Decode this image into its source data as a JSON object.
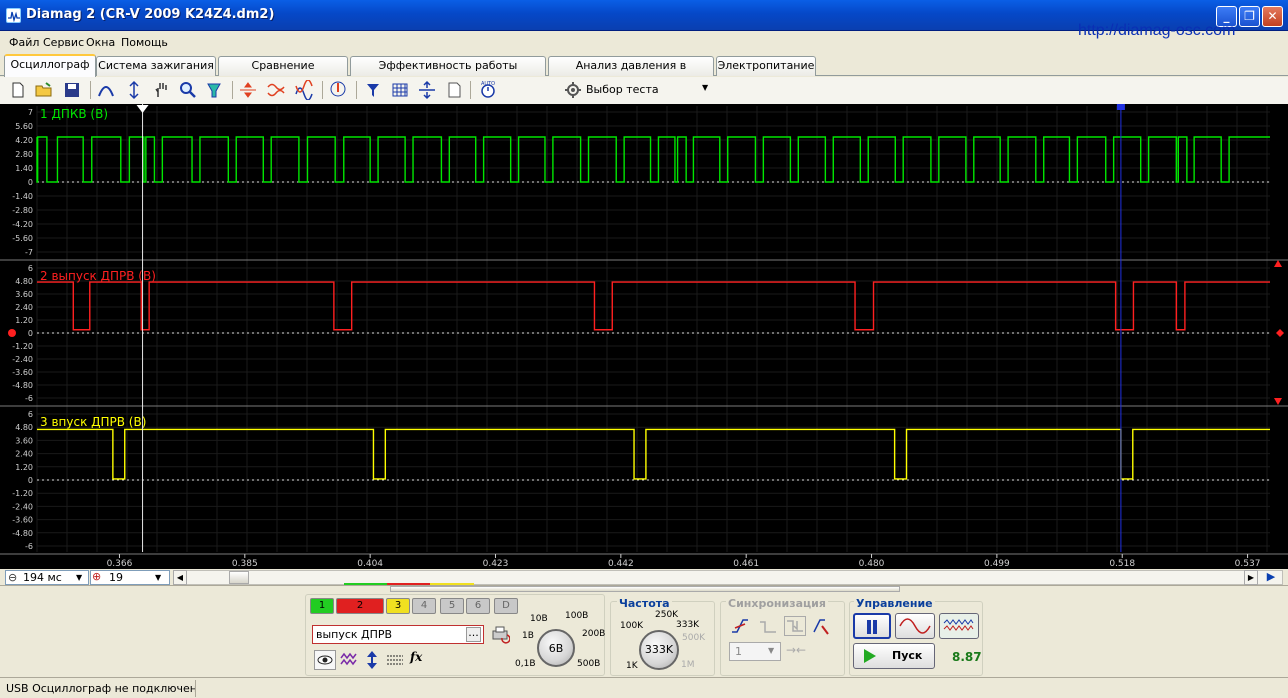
{
  "window": {
    "title": "Diamag 2 (CR-V 2009 K24Z4.dm2)",
    "url": "http://diamag-osc.com"
  },
  "menu": [
    "Файл",
    "Сервис",
    "Окна",
    "Помощь"
  ],
  "tabs": [
    {
      "label": "Осциллограф",
      "active": true
    },
    {
      "label": "Система зажигания"
    },
    {
      "label": "Сравнение цилиндров"
    },
    {
      "label": "Эффективность работы цилиндров"
    },
    {
      "label": "Анализ давления в цилиндре"
    },
    {
      "label": "Электропитание"
    }
  ],
  "toolbar": {
    "icons": [
      "new-file-icon",
      "open-folder-icon",
      "save-icon",
      "signal-arc-icon",
      "cursor-measure-icon",
      "hand-pan-icon",
      "zoom-icon",
      "probe-icon",
      "compress-icon",
      "invert-icon",
      "overlay-icon",
      "auto-scale-icon",
      "filter-icon",
      "grid-icon",
      "split-icon",
      "page-icon",
      "auto-timer-icon"
    ],
    "test_select": "Выбор теста"
  },
  "chart_data": {
    "type": "line",
    "xlabel": "",
    "ylabel": "",
    "x_ticks": [
      "0.366",
      "0.385",
      "0.404",
      "0.423",
      "0.442",
      "0.461",
      "0.480",
      "0.499",
      "0.518",
      "0.537"
    ],
    "xlim": [
      0.3535,
      0.5404
    ],
    "cursor_positions": [
      0.3695,
      0.5178
    ],
    "channels": [
      {
        "name": "1 ДПКВ (В)",
        "color": "#00e600",
        "ylim": [
          -7,
          7
        ],
        "y_ticks": [
          "7",
          "5.60",
          "4.20",
          "2.80",
          "1.40",
          "0",
          "-1.40",
          "-2.80",
          "-4.20",
          "-5.60",
          "-7"
        ],
        "low": 0,
        "high": 4.5,
        "low_pulses": [
          [
            0.3535,
            0.3536
          ],
          [
            0.355,
            0.3566
          ],
          [
            0.3605,
            0.3618
          ],
          [
            0.3662,
            0.3675
          ],
          [
            0.3697,
            0.37
          ],
          [
            0.3713,
            0.3725
          ],
          [
            0.377,
            0.3782
          ],
          [
            0.3825,
            0.3837
          ],
          [
            0.3878,
            0.389
          ],
          [
            0.3932,
            0.3945
          ],
          [
            0.3987,
            0.4
          ],
          [
            0.404,
            0.4052
          ],
          [
            0.4093,
            0.4105
          ],
          [
            0.4148,
            0.416
          ],
          [
            0.42,
            0.4212
          ],
          [
            0.4253,
            0.4265
          ],
          [
            0.4305,
            0.4317
          ],
          [
            0.4359,
            0.4371
          ],
          [
            0.4413,
            0.4425
          ],
          [
            0.4465,
            0.4477
          ],
          [
            0.4502,
            0.4506
          ],
          [
            0.4519,
            0.453
          ],
          [
            0.457,
            0.4582
          ],
          [
            0.4624,
            0.4636
          ],
          [
            0.4677,
            0.4689
          ],
          [
            0.473,
            0.4742
          ],
          [
            0.4783,
            0.4795
          ],
          [
            0.4836,
            0.4848
          ],
          [
            0.489,
            0.4902
          ],
          [
            0.4943,
            0.4955
          ],
          [
            0.4995,
            0.5007
          ],
          [
            0.5049,
            0.5061
          ],
          [
            0.51,
            0.5112
          ],
          [
            0.5155,
            0.5167
          ],
          [
            0.5208,
            0.522
          ],
          [
            0.5262,
            0.5265
          ],
          [
            0.5278,
            0.5289
          ],
          [
            0.533,
            0.5342
          ]
        ]
      },
      {
        "name": "2 выпуск ДПРВ (В)",
        "color": "#ff2020",
        "ylim": [
          -6,
          6
        ],
        "y_ticks": [
          "6",
          "4.80",
          "3.60",
          "2.40",
          "1.20",
          "0",
          "-1.20",
          "-2.40",
          "-3.60",
          "-4.80",
          "-6"
        ],
        "low": 0.3,
        "high": 4.7,
        "low_pulses": [
          [
            0.359,
            0.3615
          ],
          [
            0.3693,
            0.3705
          ],
          [
            0.3985,
            0.4012
          ],
          [
            0.438,
            0.4407
          ],
          [
            0.4775,
            0.4803
          ],
          [
            0.517,
            0.5197
          ],
          [
            0.5262,
            0.5275
          ]
        ]
      },
      {
        "name": "3 впуск ДПРВ (В)",
        "color": "#ffff00",
        "ylim": [
          -6,
          6
        ],
        "y_ticks": [
          "6",
          "4.80",
          "3.60",
          "2.40",
          "1.20",
          "0",
          "-1.20",
          "-2.40",
          "-3.60",
          "-4.80",
          "-6"
        ],
        "low": 0.1,
        "high": 4.6,
        "low_pulses": [
          [
            0.365,
            0.3668
          ],
          [
            0.4045,
            0.4063
          ],
          [
            0.444,
            0.4458
          ],
          [
            0.4835,
            0.4853
          ],
          [
            0.5178,
            0.5196
          ]
        ]
      }
    ]
  },
  "bottom": {
    "timebase": "194 мс",
    "count": "19"
  },
  "channel_panel": {
    "buttons": [
      "1",
      "2",
      "3",
      "4",
      "5",
      "6",
      "D"
    ],
    "colors": [
      "#22cc22",
      "#e02020",
      "#f0e020",
      "#c8c8c8",
      "#c8c8c8",
      "#c8c8c8",
      "#c8c8c8"
    ],
    "selected_channel": "выпуск ДПРВ",
    "volt_ticks": [
      "0,1В",
      "1В",
      "10В",
      "100В",
      "200В",
      "500В"
    ],
    "volt_value": "6В"
  },
  "frequency": {
    "label": "Частота",
    "ticks": [
      "1K",
      "100K",
      "250K",
      "333K",
      "500K",
      "1M"
    ],
    "value": "333K"
  },
  "sync": {
    "label": "Синхронизация",
    "channel": "1"
  },
  "control": {
    "label": "Управление",
    "start": "Пуск",
    "value": "8.87"
  },
  "status": "USB Осциллограф не подключен"
}
